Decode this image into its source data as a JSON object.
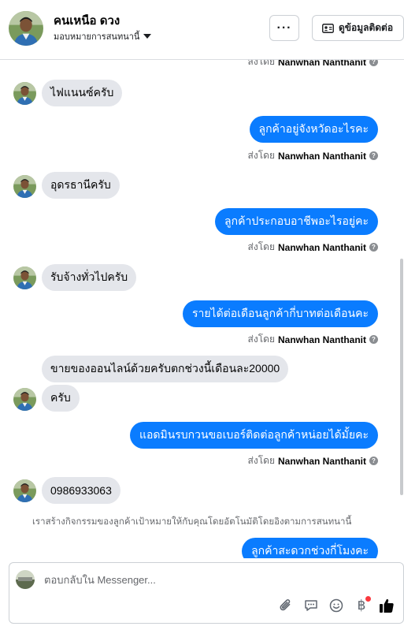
{
  "header": {
    "contact_name": "คนเหนือ ดวง",
    "assign_label": "มอบหมายการสนทนานี้",
    "more_label": "···",
    "contact_info_label": "ดูข้อมูลติดต่อ"
  },
  "sent_by": {
    "prefix": "ส่งโดย",
    "name": "Nanwhan Nanthanit"
  },
  "messages": {
    "m1": "ไฟแนนซ์ครับ",
    "m2": "ลูกค้าอยู่จังหวัดอะไรคะ",
    "m3": "อุดรธานีครับ",
    "m4": "ลูกค้าประกอบอาชีพอะไรอยู่คะ",
    "m5": "รับจ้างทั่วไปครับ",
    "m6": "รายได้ต่อเดือนลูกค้ากี่บาทต่อเดือนคะ",
    "m7": "ขายของออนไลน์ด้วยครับตกช่วงนี้เดือนละ20000",
    "m8": "ครับ",
    "m9": "แอดมินรบกวนขอเบอร์ติดต่อลูกค้าหน่อยได้มั้ยคะ",
    "m10": "0986933063",
    "m11": "ลูกค้าสะดวกช่วงกี่โมงคะ"
  },
  "system_note": "เราสร้างกิจกรรมของลูกค้าเป้าหมายให้กับคุณโดยอัตโนมัติโดยอิงตามการสนทนานี้",
  "composer": {
    "placeholder": "ตอบกลับใน Messenger...",
    "currency_symbol": "฿"
  },
  "colors": {
    "outgoing_bubble": "#0a7cff",
    "incoming_bubble": "#e4e6eb",
    "like_icon": "#050505",
    "notification_dot": "#fa383e"
  },
  "icons": [
    "more-icon",
    "contact-card-icon",
    "help-icon",
    "attachment-icon",
    "saved-reply-icon",
    "emoji-icon",
    "baht-payment-icon",
    "thumbs-up-icon"
  ]
}
